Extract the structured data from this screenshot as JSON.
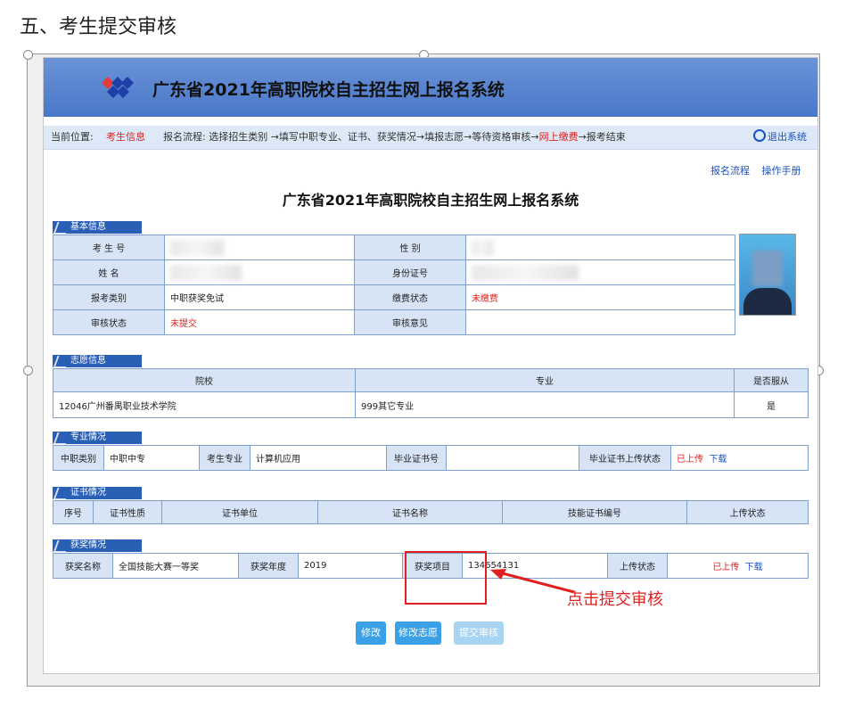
{
  "heading": "五、考生提交审核",
  "app": {
    "banner_title": "广东省2021年高职院校自主招生网上报名系统",
    "nav": {
      "label": "当前位置:",
      "current": "考生信息",
      "flow_prefix": "报名流程: 选择招生类别 →填写中职专业、证书、获奖情况→填报志愿→等待资格审核→",
      "flow_highlight": "网上缴费",
      "flow_suffix": "→报考结束",
      "logout": "退出系统"
    },
    "links": [
      "报名流程",
      "操作手册"
    ],
    "main_title": "广东省2021年高职院校自主招生网上报名系统"
  },
  "basic": {
    "tab": "基本信息",
    "exam_no_label": "考 生 号",
    "gender_label": "性 别",
    "name_label": "姓 名",
    "id_label": "身份证号",
    "category_label": "报考类别",
    "category_value": "中职获奖免试",
    "pay_label": "缴费状态",
    "pay_value": "未缴费",
    "review_label": "审核状态",
    "review_value": "未提交",
    "opinion_label": "审核意见"
  },
  "wish": {
    "tab": "志愿信息",
    "col_school": "院校",
    "col_major": "专业",
    "col_adjust": "是否服从",
    "school": "12046广州番禺职业技术学院",
    "major": "999其它专业",
    "adjust": "是"
  },
  "major_info": {
    "tab": "专业情况",
    "type_label": "中职类别",
    "type_value": "中职中专",
    "major_label": "考生专业",
    "major_value": "计算机应用",
    "cert_label": "毕业证书号",
    "upload_label": "毕业证书上传状态",
    "upload_value": "已上传",
    "download": "下载"
  },
  "cert_info": {
    "tab": "证书情况",
    "cols": [
      "序号",
      "证书性质",
      "证书单位",
      "证书名称",
      "技能证书编号",
      "上传状态"
    ]
  },
  "award": {
    "tab": "获奖情况",
    "name_label": "获奖名称",
    "name_value": "全国技能大赛一等奖",
    "year_label": "获奖年度",
    "year_value": "2019",
    "item_label": "获奖项目",
    "item_value": "134654131",
    "upload_label": "上传状态",
    "upload_value": "已上传",
    "download": "下载"
  },
  "buttons": {
    "edit": "修改",
    "edit_wish": "修改志愿",
    "submit": "提交审核"
  },
  "annotation": "点击提交审核",
  "colors": {
    "banner": "#4a77c9",
    "accent_red": "#e02020",
    "link_blue": "#1a52c4",
    "button": "#3aa1e6"
  }
}
